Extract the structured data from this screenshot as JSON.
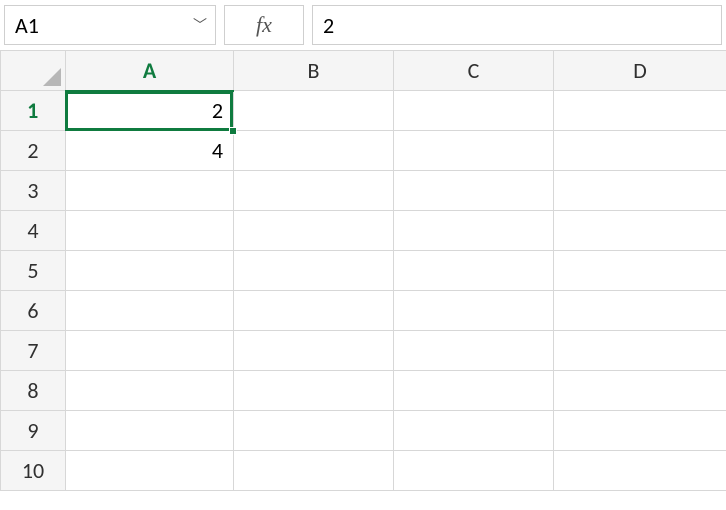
{
  "formula_bar": {
    "name_box_value": "A1",
    "fx_label": "fx",
    "formula_value": "2"
  },
  "columns": [
    "A",
    "B",
    "C",
    "D"
  ],
  "row_numbers": [
    "1",
    "2",
    "3",
    "4",
    "5",
    "6",
    "7",
    "8",
    "9",
    "10"
  ],
  "selected_cell": {
    "col": "A",
    "row": 1
  },
  "cells": {
    "A1": "2",
    "A2": "4"
  }
}
